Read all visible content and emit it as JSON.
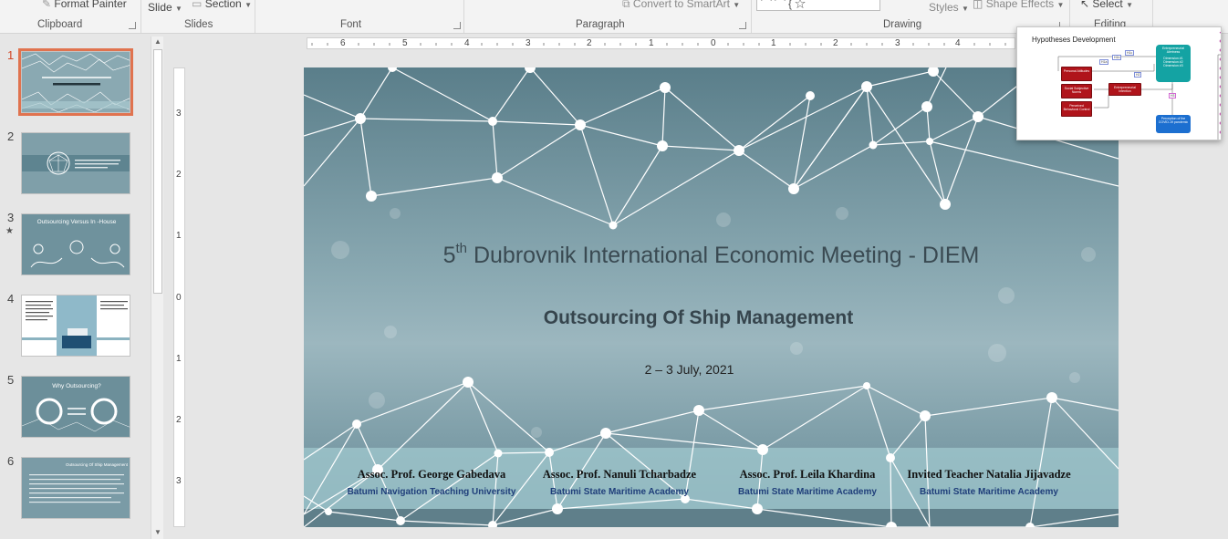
{
  "ribbon": {
    "format_painter": "Format Painter",
    "slide": "Slide",
    "section": "Section",
    "convert_smartart": "Convert to SmartArt",
    "styles": "Styles",
    "shape_effects": "Shape Effects",
    "select": "Select",
    "groups": {
      "clipboard": "Clipboard",
      "slides": "Slides",
      "font": "Font",
      "paragraph": "Paragraph",
      "drawing": "Drawing",
      "editing": "Editing"
    }
  },
  "thumbnails": [
    {
      "number": "1",
      "title": "",
      "selected": true
    },
    {
      "number": "2",
      "title": "",
      "selected": false
    },
    {
      "number": "3",
      "title": "Outsourcing Versus In -House",
      "selected": false,
      "starred": true
    },
    {
      "number": "4",
      "title": "",
      "selected": false
    },
    {
      "number": "5",
      "title": "Why Outsourcing?",
      "selected": false
    },
    {
      "number": "6",
      "title": "Outsourcing Of Ship Management",
      "selected": false
    }
  ],
  "ruler": {
    "horizontal": [
      "6",
      "5",
      "4",
      "3",
      "2",
      "1",
      "0",
      "1",
      "2",
      "3",
      "4"
    ],
    "vertical": [
      "3",
      "2",
      "1",
      "0",
      "1",
      "2",
      "3"
    ]
  },
  "slide": {
    "title_pre": "5",
    "title_sup": "th",
    "title_post": " Dubrovnik International Economic Meeting - DIEM",
    "subtitle": "Outsourcing Of Ship Management",
    "date": "2 – 3 July, 2021",
    "authors": [
      {
        "name": "Assoc. Prof. George Gabedava",
        "affiliation": "Batumi Navigation Teaching University"
      },
      {
        "name": "Assoc. Prof. Nanuli Tcharbadze",
        "affiliation": "Batumi State Maritime Academy"
      },
      {
        "name": "Assoc. Prof. Leila Khardina",
        "affiliation": "Batumi State Maritime Academy"
      },
      {
        "name": "Invited Teacher Natalia Jijavadze",
        "affiliation": "Batumi State Maritime Academy"
      }
    ]
  },
  "popup": {
    "title": "Hypotheses Development",
    "boxes": {
      "personal_attitudes": "Personal Attitudes",
      "social_norms": "Social Subjective Norms",
      "perceived_control": "Perceived Behavioral Control",
      "entrepreneurial_intention": "Entrepreneurial Intention",
      "entrepreneurial_alertness": "Entrepreneurial Alertness",
      "alertness_dims": "Dimension #1 Dimension #2 Dimension #3",
      "covid_perception": "Perception of the COVID-19 pandemic"
    },
    "labels": {
      "h1a": "H1a",
      "h1b": "H1b",
      "h1c": "H1c",
      "h2": "H2",
      "h3": "H3"
    }
  },
  "colors": {
    "accent": "#d24726",
    "slide_bg": "#8aa9b2",
    "author_affiliation": "#1f3e7a"
  }
}
